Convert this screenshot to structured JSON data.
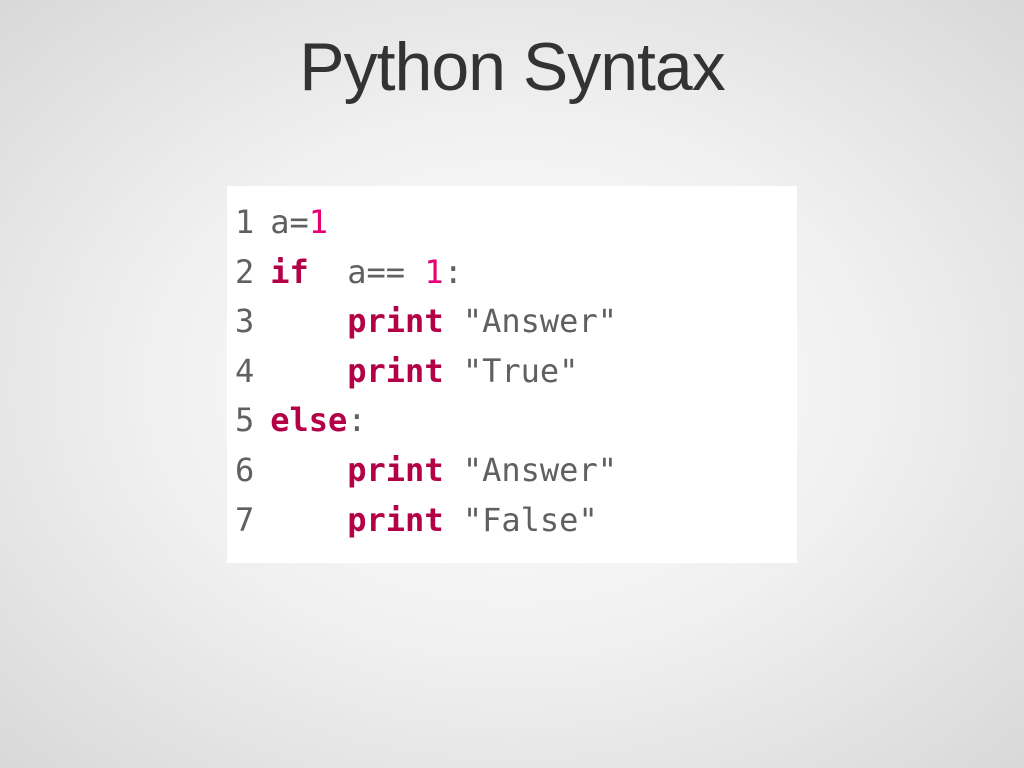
{
  "title": "Python Syntax",
  "code": {
    "lines": [
      {
        "num": "1",
        "tokens": [
          {
            "text": "a",
            "cls": "tok-var"
          },
          {
            "text": "=",
            "cls": "tok-op"
          },
          {
            "text": "1",
            "cls": "tok-num"
          }
        ]
      },
      {
        "num": "2",
        "tokens": [
          {
            "text": "if",
            "cls": "tok-kw"
          },
          {
            "text": "  a",
            "cls": "tok-var"
          },
          {
            "text": "==",
            "cls": "tok-op"
          },
          {
            "text": " 1",
            "cls": "tok-num"
          },
          {
            "text": ":",
            "cls": "tok-punc"
          }
        ]
      },
      {
        "num": "3",
        "tokens": [
          {
            "text": "    ",
            "cls": "tok-var"
          },
          {
            "text": "print",
            "cls": "tok-fn"
          },
          {
            "text": " \"Answer\"",
            "cls": "tok-str"
          }
        ]
      },
      {
        "num": "4",
        "tokens": [
          {
            "text": "    ",
            "cls": "tok-var"
          },
          {
            "text": "print",
            "cls": "tok-fn"
          },
          {
            "text": " \"True\"",
            "cls": "tok-str"
          }
        ]
      },
      {
        "num": "5",
        "tokens": [
          {
            "text": "else",
            "cls": "tok-kw"
          },
          {
            "text": ":",
            "cls": "tok-punc"
          }
        ]
      },
      {
        "num": "6",
        "tokens": [
          {
            "text": "    ",
            "cls": "tok-var"
          },
          {
            "text": "print",
            "cls": "tok-fn"
          },
          {
            "text": " \"Answer\"",
            "cls": "tok-str"
          }
        ]
      },
      {
        "num": "7",
        "tokens": [
          {
            "text": "    ",
            "cls": "tok-var"
          },
          {
            "text": "print",
            "cls": "tok-fn"
          },
          {
            "text": " \"False\"",
            "cls": "tok-str"
          }
        ]
      }
    ]
  }
}
